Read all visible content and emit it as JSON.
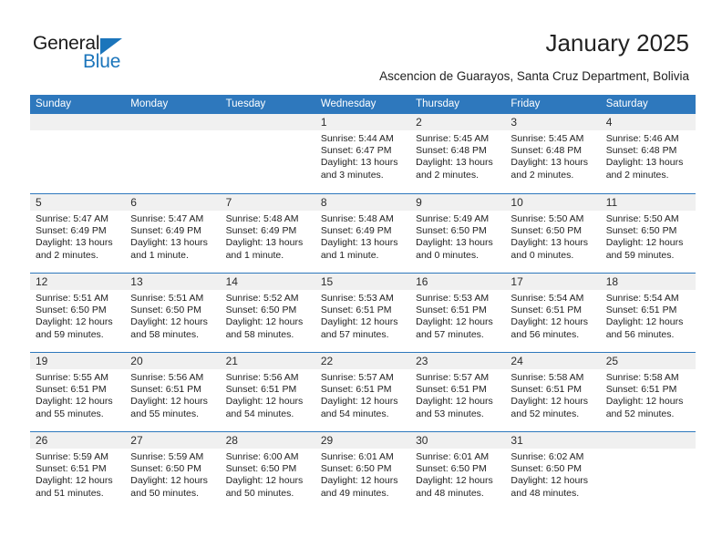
{
  "brand": {
    "name_part1": "General",
    "name_part2": "Blue",
    "accent_color": "#1b75bb",
    "triangle_icon": "triangle-icon"
  },
  "header": {
    "title": "January 2025",
    "subtitle": "Ascencion de Guarayos, Santa Cruz Department, Bolivia"
  },
  "calendar": {
    "header_bg_color": "#2e78bd",
    "day_band_color": "#f0f0f0",
    "weekday_headers": [
      "Sunday",
      "Monday",
      "Tuesday",
      "Wednesday",
      "Thursday",
      "Friday",
      "Saturday"
    ],
    "weeks": [
      [
        {
          "day": "",
          "lines": []
        },
        {
          "day": "",
          "lines": []
        },
        {
          "day": "",
          "lines": []
        },
        {
          "day": "1",
          "lines": [
            "Sunrise: 5:44 AM",
            "Sunset: 6:47 PM",
            "Daylight: 13 hours",
            "and 3 minutes."
          ]
        },
        {
          "day": "2",
          "lines": [
            "Sunrise: 5:45 AM",
            "Sunset: 6:48 PM",
            "Daylight: 13 hours",
            "and 2 minutes."
          ]
        },
        {
          "day": "3",
          "lines": [
            "Sunrise: 5:45 AM",
            "Sunset: 6:48 PM",
            "Daylight: 13 hours",
            "and 2 minutes."
          ]
        },
        {
          "day": "4",
          "lines": [
            "Sunrise: 5:46 AM",
            "Sunset: 6:48 PM",
            "Daylight: 13 hours",
            "and 2 minutes."
          ]
        }
      ],
      [
        {
          "day": "5",
          "lines": [
            "Sunrise: 5:47 AM",
            "Sunset: 6:49 PM",
            "Daylight: 13 hours",
            "and 2 minutes."
          ]
        },
        {
          "day": "6",
          "lines": [
            "Sunrise: 5:47 AM",
            "Sunset: 6:49 PM",
            "Daylight: 13 hours",
            "and 1 minute."
          ]
        },
        {
          "day": "7",
          "lines": [
            "Sunrise: 5:48 AM",
            "Sunset: 6:49 PM",
            "Daylight: 13 hours",
            "and 1 minute."
          ]
        },
        {
          "day": "8",
          "lines": [
            "Sunrise: 5:48 AM",
            "Sunset: 6:49 PM",
            "Daylight: 13 hours",
            "and 1 minute."
          ]
        },
        {
          "day": "9",
          "lines": [
            "Sunrise: 5:49 AM",
            "Sunset: 6:50 PM",
            "Daylight: 13 hours",
            "and 0 minutes."
          ]
        },
        {
          "day": "10",
          "lines": [
            "Sunrise: 5:50 AM",
            "Sunset: 6:50 PM",
            "Daylight: 13 hours",
            "and 0 minutes."
          ]
        },
        {
          "day": "11",
          "lines": [
            "Sunrise: 5:50 AM",
            "Sunset: 6:50 PM",
            "Daylight: 12 hours",
            "and 59 minutes."
          ]
        }
      ],
      [
        {
          "day": "12",
          "lines": [
            "Sunrise: 5:51 AM",
            "Sunset: 6:50 PM",
            "Daylight: 12 hours",
            "and 59 minutes."
          ]
        },
        {
          "day": "13",
          "lines": [
            "Sunrise: 5:51 AM",
            "Sunset: 6:50 PM",
            "Daylight: 12 hours",
            "and 58 minutes."
          ]
        },
        {
          "day": "14",
          "lines": [
            "Sunrise: 5:52 AM",
            "Sunset: 6:50 PM",
            "Daylight: 12 hours",
            "and 58 minutes."
          ]
        },
        {
          "day": "15",
          "lines": [
            "Sunrise: 5:53 AM",
            "Sunset: 6:51 PM",
            "Daylight: 12 hours",
            "and 57 minutes."
          ]
        },
        {
          "day": "16",
          "lines": [
            "Sunrise: 5:53 AM",
            "Sunset: 6:51 PM",
            "Daylight: 12 hours",
            "and 57 minutes."
          ]
        },
        {
          "day": "17",
          "lines": [
            "Sunrise: 5:54 AM",
            "Sunset: 6:51 PM",
            "Daylight: 12 hours",
            "and 56 minutes."
          ]
        },
        {
          "day": "18",
          "lines": [
            "Sunrise: 5:54 AM",
            "Sunset: 6:51 PM",
            "Daylight: 12 hours",
            "and 56 minutes."
          ]
        }
      ],
      [
        {
          "day": "19",
          "lines": [
            "Sunrise: 5:55 AM",
            "Sunset: 6:51 PM",
            "Daylight: 12 hours",
            "and 55 minutes."
          ]
        },
        {
          "day": "20",
          "lines": [
            "Sunrise: 5:56 AM",
            "Sunset: 6:51 PM",
            "Daylight: 12 hours",
            "and 55 minutes."
          ]
        },
        {
          "day": "21",
          "lines": [
            "Sunrise: 5:56 AM",
            "Sunset: 6:51 PM",
            "Daylight: 12 hours",
            "and 54 minutes."
          ]
        },
        {
          "day": "22",
          "lines": [
            "Sunrise: 5:57 AM",
            "Sunset: 6:51 PM",
            "Daylight: 12 hours",
            "and 54 minutes."
          ]
        },
        {
          "day": "23",
          "lines": [
            "Sunrise: 5:57 AM",
            "Sunset: 6:51 PM",
            "Daylight: 12 hours",
            "and 53 minutes."
          ]
        },
        {
          "day": "24",
          "lines": [
            "Sunrise: 5:58 AM",
            "Sunset: 6:51 PM",
            "Daylight: 12 hours",
            "and 52 minutes."
          ]
        },
        {
          "day": "25",
          "lines": [
            "Sunrise: 5:58 AM",
            "Sunset: 6:51 PM",
            "Daylight: 12 hours",
            "and 52 minutes."
          ]
        }
      ],
      [
        {
          "day": "26",
          "lines": [
            "Sunrise: 5:59 AM",
            "Sunset: 6:51 PM",
            "Daylight: 12 hours",
            "and 51 minutes."
          ]
        },
        {
          "day": "27",
          "lines": [
            "Sunrise: 5:59 AM",
            "Sunset: 6:50 PM",
            "Daylight: 12 hours",
            "and 50 minutes."
          ]
        },
        {
          "day": "28",
          "lines": [
            "Sunrise: 6:00 AM",
            "Sunset: 6:50 PM",
            "Daylight: 12 hours",
            "and 50 minutes."
          ]
        },
        {
          "day": "29",
          "lines": [
            "Sunrise: 6:01 AM",
            "Sunset: 6:50 PM",
            "Daylight: 12 hours",
            "and 49 minutes."
          ]
        },
        {
          "day": "30",
          "lines": [
            "Sunrise: 6:01 AM",
            "Sunset: 6:50 PM",
            "Daylight: 12 hours",
            "and 48 minutes."
          ]
        },
        {
          "day": "31",
          "lines": [
            "Sunrise: 6:02 AM",
            "Sunset: 6:50 PM",
            "Daylight: 12 hours",
            "and 48 minutes."
          ]
        },
        {
          "day": "",
          "lines": []
        }
      ]
    ]
  }
}
